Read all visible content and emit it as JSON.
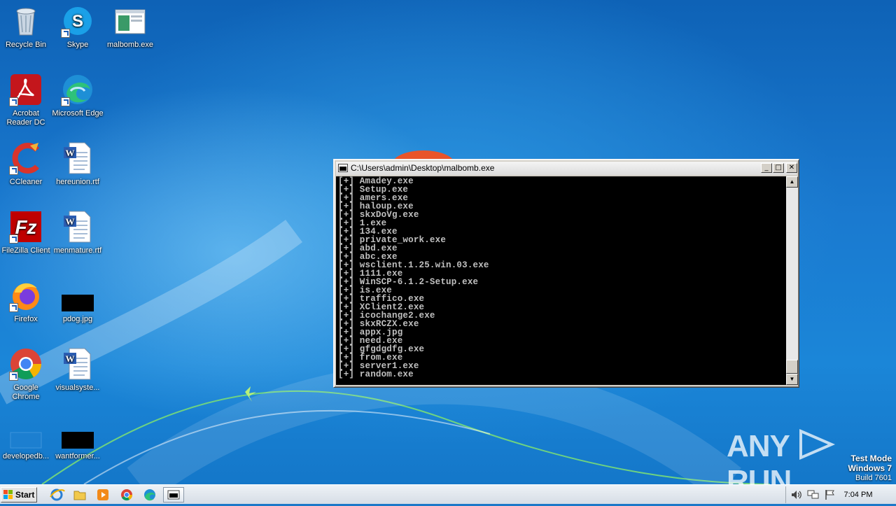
{
  "desktop_icons": [
    {
      "label": "Recycle Bin",
      "icon": "recycle-bin-icon"
    },
    {
      "label": "Skype",
      "icon": "skype-icon"
    },
    {
      "label": "malbomb.exe",
      "icon": "exe-window-icon"
    },
    {
      "label": "Acrobat Reader DC",
      "icon": "acrobat-icon"
    },
    {
      "label": "Microsoft Edge",
      "icon": "edge-icon"
    },
    {
      "label": "CCleaner",
      "icon": "ccleaner-icon"
    },
    {
      "label": "hereunion.rtf",
      "icon": "word-document-icon"
    },
    {
      "label": "FileZilla Client",
      "icon": "filezilla-icon"
    },
    {
      "label": "menmature.rtf",
      "icon": "word-document-icon"
    },
    {
      "label": "Firefox",
      "icon": "firefox-icon"
    },
    {
      "label": "pdog.jpg",
      "icon": "black-image-icon"
    },
    {
      "label": "Google Chrome",
      "icon": "chrome-icon"
    },
    {
      "label": "visualsyste...",
      "icon": "word-document-icon"
    },
    {
      "label": "developedb...",
      "icon": "blank-file-icon"
    },
    {
      "label": "wantformer...",
      "icon": "black-image-icon"
    }
  ],
  "console": {
    "title": "C:\\Users\\admin\\Desktop\\malbomb.exe",
    "lines": [
      "[+] Amadey.exe",
      "[+] Setup.exe",
      "[+] amers.exe",
      "[+] haloup.exe",
      "[+] skxDoVg.exe",
      "[+] 1.exe",
      "[+] 134.exe",
      "[+] private_work.exe",
      "[+] abd.exe",
      "[+] abc.exe",
      "[+] wsclient.1.25.win.03.exe",
      "[+] 1111.exe",
      "[+] WinSCP-6.1.2-Setup.exe",
      "[+] is.exe",
      "[+] traffico.exe",
      "[+] XClient2.exe",
      "[+] icochange2.exe",
      "[+] skxRCZX.exe",
      "[+] appx.jpg",
      "[+] need.exe",
      "[+] gfgdgdfg.exe",
      "[+] from.exe",
      "[+] server1.exe",
      "[+] random.exe"
    ],
    "buttons": {
      "minimize": "_",
      "maximize": "□",
      "close": "✕"
    },
    "scroll_up": "▲",
    "scroll_down": "▼"
  },
  "watermark": {
    "brand_left": "ANY",
    "brand_right": "RUN",
    "mode": "Test Mode",
    "os": "Windows 7",
    "build": "Build 7601"
  },
  "taskbar": {
    "start_label": "Start",
    "apps": [
      "internet-explorer-icon",
      "explorer-folder-icon",
      "media-player-icon",
      "chrome-icon",
      "edge-icon",
      "console-window-icon"
    ],
    "tray_icons": [
      "volume-icon",
      "network-icon",
      "action-center-flag-icon"
    ],
    "clock": "7:04 PM"
  }
}
